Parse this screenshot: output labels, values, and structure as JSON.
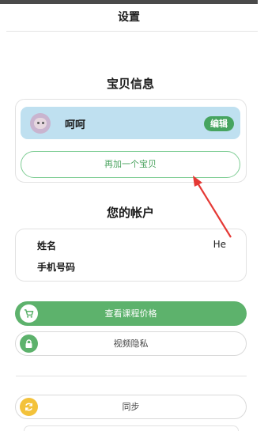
{
  "header": {
    "title": "设置"
  },
  "baby_section": {
    "title": "宝贝信息",
    "baby": {
      "name": "呵呵",
      "edit_label": "编辑"
    },
    "add_label": "再加一个宝贝"
  },
  "account_section": {
    "title": "您的帐户",
    "rows": [
      {
        "label": "姓名",
        "value": "He"
      },
      {
        "label": "手机号码",
        "value": ""
      }
    ]
  },
  "actions": {
    "course_price": {
      "label": "查看课程价格",
      "icon": "cart-icon"
    },
    "video_privacy": {
      "label": "视频隐私",
      "icon": "lock-icon"
    },
    "sync": {
      "label": "同步",
      "icon": "sync-icon"
    }
  },
  "colors": {
    "green": "#5db26c",
    "baby_row_bg": "#bfe0f0",
    "annotation_arrow": "#e53935",
    "sync_yellow": "#f3c23a"
  }
}
